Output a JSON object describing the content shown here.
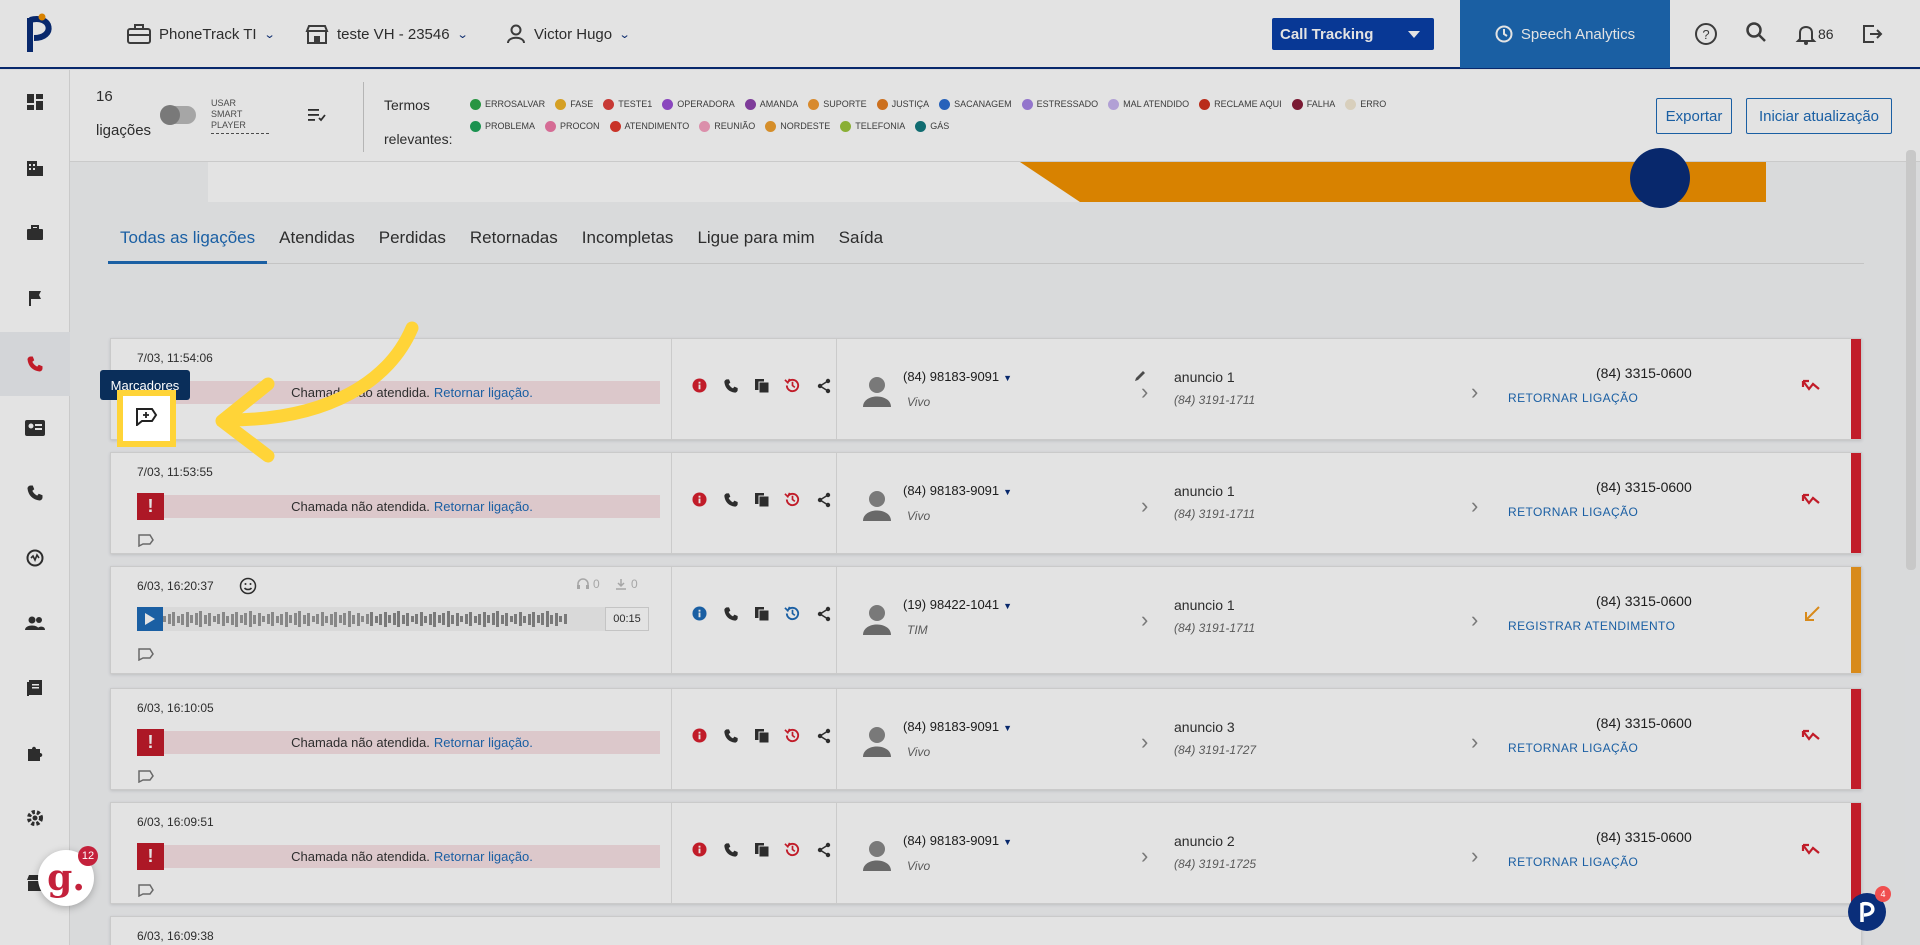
{
  "header": {
    "account": "PhoneTrack TI",
    "store": "teste VH - 23546",
    "user": "Victor Hugo",
    "module_select": "Call Tracking",
    "speech_analytics": "Speech Analytics",
    "notifications_count": "86"
  },
  "filters": {
    "count": "16",
    "count_label": "ligações",
    "smart_player_label": "USAR SMART PLAYER",
    "termos_label": "Termos relevantes:",
    "terms": [
      {
        "label": "ERROSALVAR",
        "color": "#2ea84a"
      },
      {
        "label": "FASE",
        "color": "#f0b429"
      },
      {
        "label": "TESTE1",
        "color": "#e0413c"
      },
      {
        "label": "OPERADORA",
        "color": "#9b4fd6"
      },
      {
        "label": "AMANDA",
        "color": "#8e44ad"
      },
      {
        "label": "SUPORTE",
        "color": "#f39c33"
      },
      {
        "label": "JUSTIÇA",
        "color": "#e67e22"
      },
      {
        "label": "SACANAGEM",
        "color": "#2c6fd1"
      },
      {
        "label": "ESTRESSADO",
        "color": "#a684e6"
      },
      {
        "label": "MAL ATENDIDO",
        "color": "#c7b4f0"
      },
      {
        "label": "RECLAME AQUI",
        "color": "#d0321e"
      },
      {
        "label": "FALHA",
        "color": "#8a1e3a"
      },
      {
        "label": "ERRO",
        "color": "#f3e9d4"
      },
      {
        "label": "PROBLEMA",
        "color": "#1fa55a"
      },
      {
        "label": "PROCON",
        "color": "#f07aa8"
      },
      {
        "label": "ATENDIMENTO",
        "color": "#e23a2d"
      },
      {
        "label": "REUNIÃO",
        "color": "#f7a1c0"
      },
      {
        "label": "NORDESTE",
        "color": "#f0a030"
      },
      {
        "label": "TELEFONIA",
        "color": "#9bc53d"
      },
      {
        "label": "GÁS",
        "color": "#137a7f"
      }
    ],
    "export": "Exportar",
    "start_update": "Iniciar atualização"
  },
  "tabs": [
    "Todas as ligações",
    "Atendidas",
    "Perdidas",
    "Retornadas",
    "Incompletas",
    "Ligue para mim",
    "Saída"
  ],
  "calls": [
    {
      "time": "7/03, 11:54:06",
      "type": "missed",
      "missed_text": "Chamada não atendida.",
      "return_link": "Retornar ligação.",
      "caller": "(84) 98183-9091",
      "carrier": "Vivo",
      "ad": "anuncio 1",
      "ad_number": "(84) 3191-1711",
      "dest": "(84) 3315-0600",
      "action": "RETORNAR LIGAÇÃO",
      "status_color": "#d9202f"
    },
    {
      "time": "7/03, 11:53:55",
      "type": "missed",
      "missed_text": "Chamada não atendida.",
      "return_link": "Retornar ligação.",
      "caller": "(84) 98183-9091",
      "carrier": "Vivo",
      "ad": "anuncio 1",
      "ad_number": "(84) 3191-1711",
      "dest": "(84) 3315-0600",
      "action": "RETORNAR LIGAÇÃO",
      "status_color": "#d9202f"
    },
    {
      "time": "6/03, 16:20:37",
      "type": "answered",
      "listens": "0",
      "downloads": "0",
      "duration": "00:15",
      "caller": "(19) 98422-1041",
      "carrier": "TIM",
      "ad": "anuncio 1",
      "ad_number": "(84) 3191-1711",
      "dest": "(84) 3315-0600",
      "action": "REGISTRAR ATENDIMENTO",
      "status_color": "#f39c1f"
    },
    {
      "time": "6/03, 16:10:05",
      "type": "missed",
      "missed_text": "Chamada não atendida.",
      "return_link": "Retornar ligação.",
      "caller": "(84) 98183-9091",
      "carrier": "Vivo",
      "ad": "anuncio 3",
      "ad_number": "(84) 3191-1727",
      "dest": "(84) 3315-0600",
      "action": "RETORNAR LIGAÇÃO",
      "status_color": "#d9202f"
    },
    {
      "time": "6/03, 16:09:51",
      "type": "missed",
      "missed_text": "Chamada não atendida.",
      "return_link": "Retornar ligação.",
      "caller": "(84) 98183-9091",
      "carrier": "Vivo",
      "ad": "anuncio 2",
      "ad_number": "(84) 3191-1725",
      "dest": "(84) 3315-0600",
      "action": "RETORNAR LIGAÇÃO",
      "status_color": "#d9202f"
    },
    {
      "time": "6/03, 16:09:38"
    }
  ],
  "tooltip": "Marcadores",
  "badges": {
    "g_count": "12",
    "p_count": "4"
  }
}
